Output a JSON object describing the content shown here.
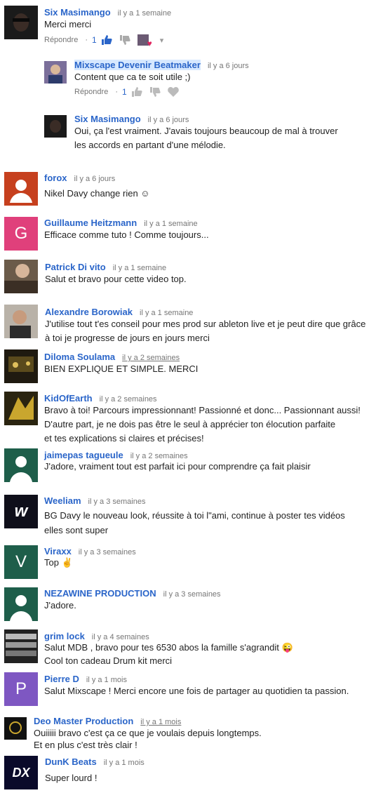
{
  "labels": {
    "reply": "Répondre",
    "dot": "·"
  },
  "comments": [
    {
      "author": "Six Masimango",
      "time": "il y a 1 semaine",
      "lines": [
        "Merci merci"
      ],
      "likes": "1"
    },
    {
      "author": "Mixscape Devenir Beatmaker",
      "time": "il y a 6 jours",
      "lines": [
        "Content que ca te soit utile ;)"
      ],
      "likes": "1"
    },
    {
      "author": "Six Masimango",
      "time": "il y a 6 jours",
      "lines": [
        "Oui, ça l'est vraiment. J'avais toujours beaucoup de mal à trouver",
        "les accords en partant d'une mélodie."
      ]
    },
    {
      "author": "forox",
      "time": "il y a 6 jours",
      "lines": [
        "Nikel Davy change rien ☺"
      ]
    },
    {
      "author": "Guillaume Heitzmann",
      "time": "il y a 1 semaine",
      "lines": [
        "Efficace comme tuto ! Comme toujours..."
      ],
      "initial": "G",
      "color": "#e0407b"
    },
    {
      "author": "Patrick Di vito",
      "time": "il y a 1 semaine",
      "lines": [
        "Salut et bravo pour cette video top."
      ]
    },
    {
      "author": "Alexandre Borowiak",
      "time": "il y a 1 semaine",
      "lines": [
        "J'utilise tout t'es conseil pour mes prod sur ableton live et je peut dire que grâce",
        "à toi je progresse de jours en jours merci"
      ]
    },
    {
      "author": "Diloma Soulama",
      "time": "il y a 2 semaines",
      "lines": [
        "BIEN EXPLIQUE ET SIMPLE. MERCI"
      ]
    },
    {
      "author": "KidOfEarth",
      "time": "il y a 2 semaines",
      "lines": [
        "Bravo à toi! Parcours impressionnant! Passionné et donc... Passionnant aussi!",
        "D'autre part, je ne dois pas être le seul à apprécier ton élocution  parfaite",
        "et tes explications si claires et précises!"
      ]
    },
    {
      "author": "jaimepas tagueule",
      "time": "il y a 2 semaines",
      "lines": [
        "J'adore, vraiment tout est parfait ici pour comprendre ça fait plaisir"
      ]
    },
    {
      "author": "Weeliam",
      "time": "il y a 3 semaines",
      "lines": [
        "BG Davy le nouveau look, réussite à toi l\"ami, continue à poster tes vidéos",
        "elles sont super"
      ],
      "initial": "w"
    },
    {
      "author": "Viraxx",
      "time": "il y a 3 semaines",
      "lines": [
        "Top ✌"
      ],
      "initial": "V",
      "color": "#1e5e4a"
    },
    {
      "author": "NEZAWINE PRODUCTION",
      "time": "il y a 3 semaines",
      "lines": [
        "J'adore."
      ]
    },
    {
      "author": "grim lock",
      "time": "il y a 4 semaines",
      "lines": [
        "Salut MDB , bravo pour tes 6530 abos la famille s'agrandit 😜",
        "Cool ton cadeau Drum kit merci"
      ]
    },
    {
      "author": "Pierre D",
      "time": "il y a 1 mois",
      "lines": [
        "Salut Mixscape ! Merci encore une fois de partager  au quotidien ta passion."
      ],
      "initial": "P",
      "color": "#7e57c2"
    },
    {
      "author": "Deo Master Production",
      "time": "il y a 1 mois",
      "lines": [
        "Ouiiiii bravo c'est ça ce que je voulais depuis longtemps.",
        "Et en plus c'est très clair !"
      ]
    },
    {
      "author": "DunK Beats",
      "time": "il y a 1 mois",
      "lines": [
        "Super lourd !"
      ],
      "initial": "DX"
    }
  ],
  "icons": [
    "thumb-up-icon",
    "thumb-down-icon",
    "heart-icon",
    "chevron-down-icon"
  ]
}
